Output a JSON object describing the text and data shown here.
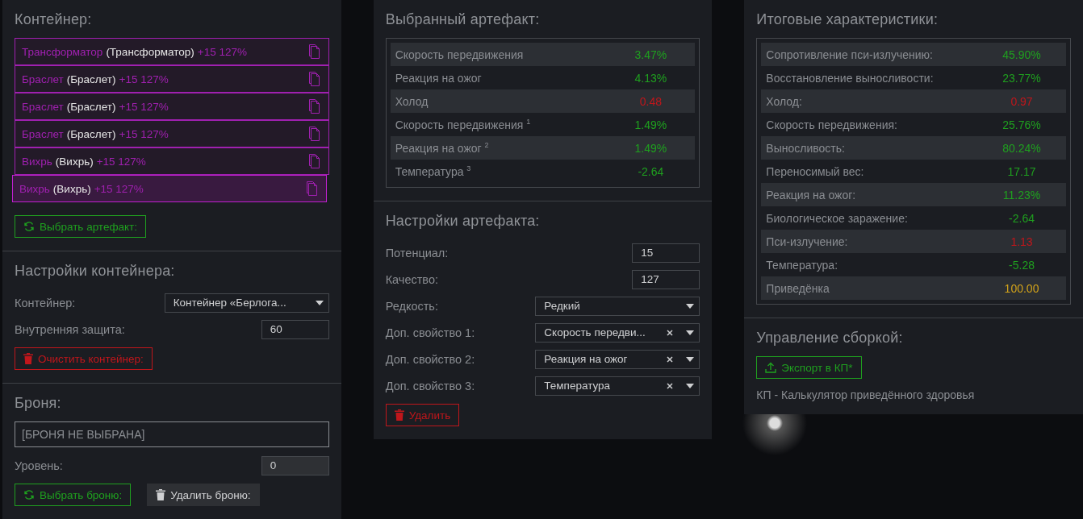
{
  "container": {
    "title": "Контейнер:",
    "items": [
      {
        "name": "Трансформатор",
        "type": "(Трансформатор)",
        "bonus": "+15 127%",
        "selected": false
      },
      {
        "name": "Браслет",
        "type": "(Браслет)",
        "bonus": "+15 127%",
        "selected": false
      },
      {
        "name": "Браслет",
        "type": "(Браслет)",
        "bonus": "+15 127%",
        "selected": false
      },
      {
        "name": "Браслет",
        "type": "(Браслет)",
        "bonus": "+15 127%",
        "selected": false
      },
      {
        "name": "Вихрь",
        "type": "(Вихрь)",
        "bonus": "+15 127%",
        "selected": false
      },
      {
        "name": "Вихрь",
        "type": "(Вихрь)",
        "bonus": "+15 127%",
        "selected": true
      }
    ],
    "select_button": {
      "label": "Выбрать артефакт:",
      "kind": "pick"
    }
  },
  "container_settings": {
    "title": "Настройки контейнера:",
    "fields": [
      {
        "kind": "select",
        "label": "Контейнер:",
        "value": "Контейнер «Берлога..."
      },
      {
        "kind": "input",
        "label": "Внутренняя защита:",
        "value": "60",
        "disabled": false
      }
    ],
    "buttons": [
      {
        "label": "Очистить контейнер:",
        "kind": "danger"
      }
    ]
  },
  "armor": {
    "title": "Броня:",
    "value": "[БРОНЯ НЕ ВЫБРАНА]",
    "fields": [
      {
        "kind": "input",
        "label": "Уровень:",
        "value": "0",
        "disabled": true
      }
    ],
    "buttons": [
      {
        "label": "Выбрать броню:",
        "kind": "pick"
      },
      {
        "label": "Удалить броню:",
        "kind": "remove"
      }
    ]
  },
  "selected_artifact": {
    "title": "Выбранный артефакт:",
    "stats": [
      {
        "label": "Скорость передвижения",
        "value": "3.47%",
        "kind": "good"
      },
      {
        "label": "Реакция на ожог",
        "value": "4.13%",
        "kind": "good"
      },
      {
        "label": "Холод",
        "value": "0.48",
        "kind": "bad"
      },
      {
        "label": "Скорость передвижения $^{1}$",
        "value": "1.49%",
        "kind": "good"
      },
      {
        "label": "Реакция на ожог $^{2}$",
        "value": "1.49%",
        "kind": "good"
      },
      {
        "label": "Температура $^{3}$",
        "value": "-2.64",
        "kind": "good"
      }
    ]
  },
  "artifact_settings": {
    "title": "Настройки артефакта:",
    "fields": [
      {
        "kind": "input",
        "label": "Потенциал:",
        "value": "15",
        "disabled": false
      },
      {
        "kind": "input",
        "label": "Качество:",
        "value": "127",
        "disabled": false
      },
      {
        "kind": "select",
        "label": "Редкость:",
        "value": "Редкий"
      },
      {
        "kind": "select",
        "label": "Доп. свойство 1:",
        "value": "Скорость передви...",
        "clearable": true
      },
      {
        "kind": "select",
        "label": "Доп. свойство 2:",
        "value": "Реакция на ожог",
        "clearable": true
      },
      {
        "kind": "select",
        "label": "Доп. свойство 3:",
        "value": "Температура",
        "clearable": true
      }
    ],
    "buttons": [
      {
        "label": "Удалить",
        "kind": "danger"
      }
    ]
  },
  "totals": {
    "title": "Итоговые характеристики:",
    "stats": [
      {
        "label": "Сопротивление пси-излучению:",
        "value": "45.90%",
        "kind": "good"
      },
      {
        "label": "Восстановление выносливости:",
        "value": "23.77%",
        "kind": "good"
      },
      {
        "label": "Холод:",
        "value": "0.97",
        "kind": "bad"
      },
      {
        "label": "Скорость передвижения:",
        "value": "25.76%",
        "kind": "good"
      },
      {
        "label": "Выносливость:",
        "value": "80.24%",
        "kind": "good"
      },
      {
        "label": "Переносимый вес:",
        "value": "17.17",
        "kind": "good"
      },
      {
        "label": "Реакция на ожог:",
        "value": "11.23%",
        "kind": "good"
      },
      {
        "label": "Биологическое заражение:",
        "value": "-2.64",
        "kind": "good"
      },
      {
        "label": "Пси-излучение:",
        "value": "1.13",
        "kind": "bad"
      },
      {
        "label": "Температура:",
        "value": "-5.28",
        "kind": "good"
      },
      {
        "label": "Приведёнка",
        "value": "100.00",
        "kind": "total"
      }
    ]
  },
  "build": {
    "title": "Управление сборкой:",
    "buttons": [
      {
        "label": "Экспорт в КП*",
        "kind": "export"
      }
    ],
    "note": "КП - Калькулятор приведённого здоровья"
  }
}
